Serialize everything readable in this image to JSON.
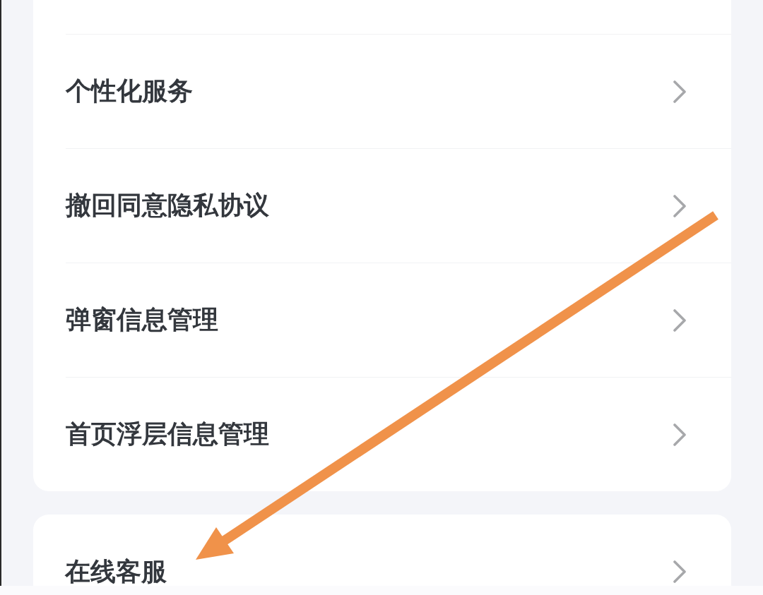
{
  "settings_groups": [
    {
      "items": [
        {
          "label": "个性化服务"
        },
        {
          "label": "撤回同意隐私协议"
        },
        {
          "label": "弹窗信息管理"
        },
        {
          "label": "首页浮层信息管理"
        }
      ]
    },
    {
      "items": [
        {
          "label": "在线客服"
        }
      ]
    }
  ]
}
